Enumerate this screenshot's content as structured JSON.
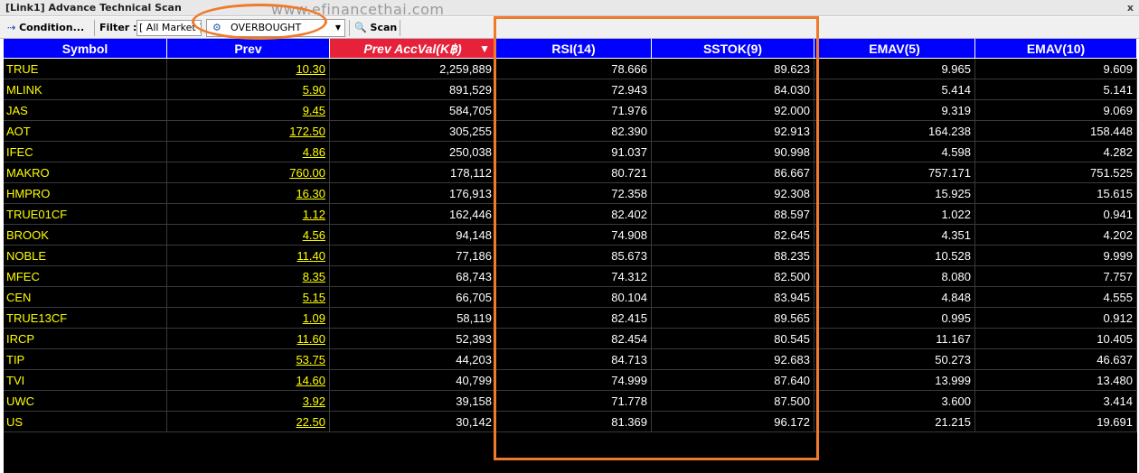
{
  "window": {
    "title": "[Link1] Advance Technical Scan",
    "close_glyph": "x"
  },
  "watermark": "www.efinancethai.com",
  "toolbar": {
    "condition_label": "Condition...",
    "filter_label": "Filter :",
    "filter_value": "[ All Market ]",
    "scan_type": "OVERBOUGHT",
    "scan_label": "Scan"
  },
  "table": {
    "columns": [
      "Symbol",
      "Prev",
      "Prev AccVal(K฿)",
      "RSI(14)",
      "SSTOK(9)",
      "EMAV(5)",
      "EMAV(10)"
    ],
    "sorted_column": "Prev AccVal(K฿)",
    "rows": [
      [
        "TRUE",
        "10.30",
        "2,259,889",
        "78.666",
        "89.623",
        "9.965",
        "9.609"
      ],
      [
        "MLINK",
        "5.90",
        "891,529",
        "72.943",
        "84.030",
        "5.414",
        "5.141"
      ],
      [
        "JAS",
        "9.45",
        "584,705",
        "71.976",
        "92.000",
        "9.319",
        "9.069"
      ],
      [
        "AOT",
        "172.50",
        "305,255",
        "82.390",
        "92.913",
        "164.238",
        "158.448"
      ],
      [
        "IFEC",
        "4.86",
        "250,038",
        "91.037",
        "90.998",
        "4.598",
        "4.282"
      ],
      [
        "MAKRO",
        "760.00",
        "178,112",
        "80.721",
        "86.667",
        "757.171",
        "751.525"
      ],
      [
        "HMPRO",
        "16.30",
        "176,913",
        "72.358",
        "92.308",
        "15.925",
        "15.615"
      ],
      [
        "TRUE01CF",
        "1.12",
        "162,446",
        "82.402",
        "88.597",
        "1.022",
        "0.941"
      ],
      [
        "BROOK",
        "4.56",
        "94,148",
        "74.908",
        "82.645",
        "4.351",
        "4.202"
      ],
      [
        "NOBLE",
        "11.40",
        "77,186",
        "85.673",
        "88.235",
        "10.528",
        "9.999"
      ],
      [
        "MFEC",
        "8.35",
        "68,743",
        "74.312",
        "82.500",
        "8.080",
        "7.757"
      ],
      [
        "CEN",
        "5.15",
        "66,705",
        "80.104",
        "83.945",
        "4.848",
        "4.555"
      ],
      [
        "TRUE13CF",
        "1.09",
        "58,119",
        "82.415",
        "89.565",
        "0.995",
        "0.912"
      ],
      [
        "IRCP",
        "11.60",
        "52,393",
        "82.454",
        "80.545",
        "11.167",
        "10.405"
      ],
      [
        "TIP",
        "53.75",
        "44,203",
        "84.713",
        "92.683",
        "50.273",
        "46.637"
      ],
      [
        "TVI",
        "14.60",
        "40,799",
        "74.999",
        "87.640",
        "13.999",
        "13.480"
      ],
      [
        "UWC",
        "3.92",
        "39,158",
        "71.778",
        "87.500",
        "3.600",
        "3.414"
      ],
      [
        "US",
        "22.50",
        "30,142",
        "81.369",
        "96.172",
        "21.215",
        "19.691"
      ]
    ]
  },
  "colors": {
    "header_bg": "#0000ff",
    "sorted_header_bg": "#e8213a",
    "grid_bg": "#000000",
    "symbol_text": "#ffff00",
    "annotation": "#f07a2c"
  }
}
